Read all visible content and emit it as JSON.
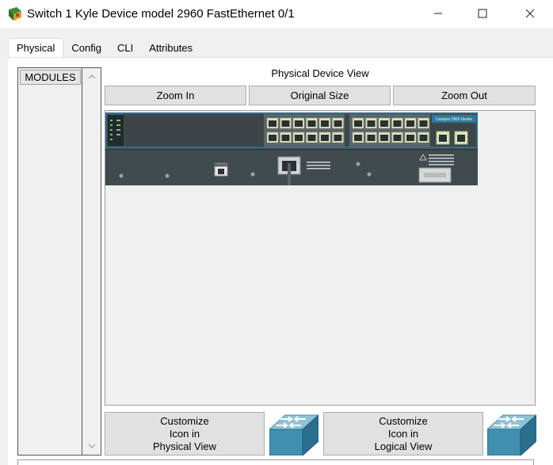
{
  "window": {
    "title": "Switch 1 Kyle Device model 2960 FastEthernet 0/1",
    "minimize_glyph": "—",
    "maximize_glyph": "☐",
    "close_glyph": "✕"
  },
  "tabs": [
    {
      "label": "Physical",
      "active": true
    },
    {
      "label": "Config",
      "active": false
    },
    {
      "label": "CLI",
      "active": false
    },
    {
      "label": "Attributes",
      "active": false
    }
  ],
  "modules": {
    "header": "MODULES",
    "scroll_up": "︿",
    "scroll_down": "﹀"
  },
  "physical_view": {
    "title": "Physical Device View",
    "zoom_in": "Zoom In",
    "original_size": "Original Size",
    "zoom_out": "Zoom Out",
    "device": {
      "brand_label": "Catalyst 2960",
      "series_label": "Series",
      "console_label": "CONSOLE",
      "chassis_color": "#3d4549",
      "accent_color": "#1f6a8a",
      "port_color": "#9aa4a8"
    }
  },
  "customize": {
    "physical_label_1": "Customize",
    "physical_label_2": "Icon in",
    "physical_label_3": "Physical View",
    "logical_label_1": "Customize",
    "logical_label_2": "Icon in",
    "logical_label_3": "Logical View"
  },
  "icons": {
    "app": "packet-tracer-icon",
    "switch": "switch-icon"
  }
}
